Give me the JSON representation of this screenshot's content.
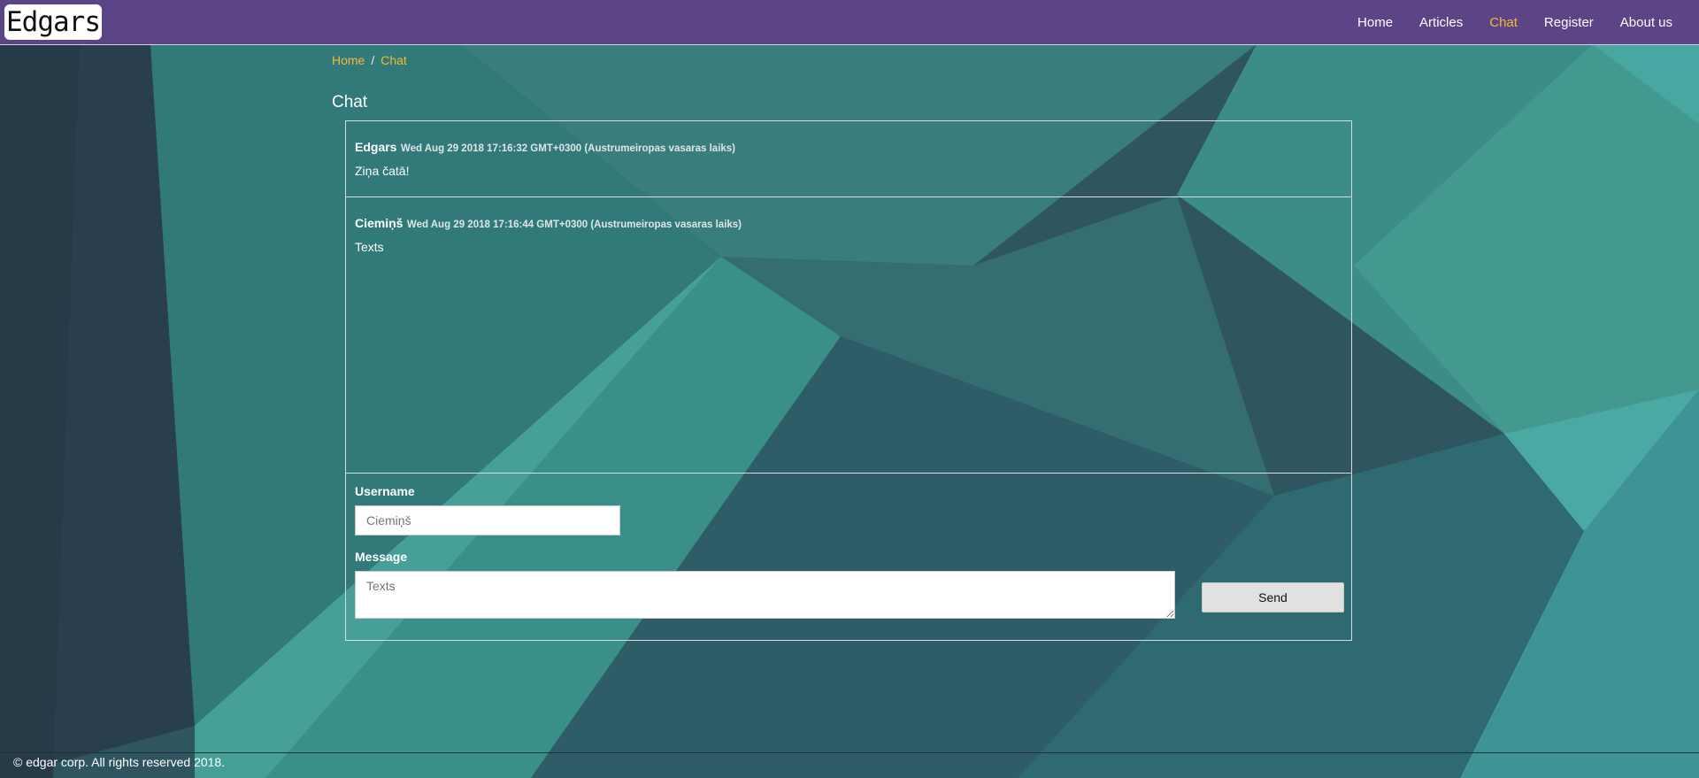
{
  "brand": {
    "logo_text": "Edgars"
  },
  "nav": {
    "items": [
      {
        "label": "Home"
      },
      {
        "label": "Articles"
      },
      {
        "label": "Chat"
      },
      {
        "label": "Register"
      },
      {
        "label": "About us"
      }
    ],
    "active": "Chat"
  },
  "breadcrumb": {
    "home": "Home",
    "separator": "/",
    "current": "Chat"
  },
  "page": {
    "title": "Chat"
  },
  "messages": [
    {
      "user": "Edgars",
      "time": "Wed Aug 29 2018 17:16:32 GMT+0300 (Austrumeiropas vasaras laiks)",
      "text": "Ziņa čatā!"
    },
    {
      "user": "Ciemiņš",
      "time": "Wed Aug 29 2018 17:16:44 GMT+0300 (Austrumeiropas vasaras laiks)",
      "text": "Texts"
    }
  ],
  "form": {
    "username_label": "Username",
    "username_placeholder": "Ciemiņš",
    "message_label": "Message",
    "message_placeholder": "Texts",
    "send_label": "Send"
  },
  "footer": {
    "text": "© edgar corp. All rights reserved 2018."
  },
  "colors": {
    "navbar": "#5c4587",
    "active_link": "#f7b733",
    "background": "#2e4f5c"
  }
}
